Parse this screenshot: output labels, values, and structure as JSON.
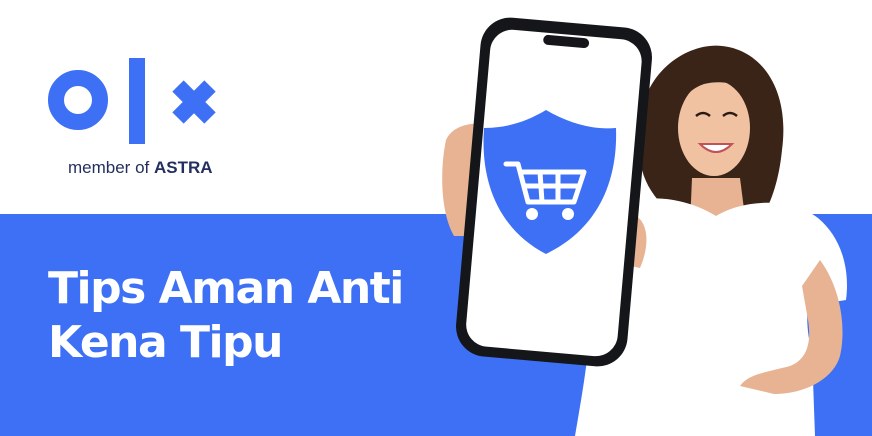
{
  "brand": {
    "tagline_prefix": "member of",
    "tagline_brand": "ASTRA",
    "logo_color": "#3d70f5",
    "text_color": "#23305f"
  },
  "headline": {
    "line1": "Tips Aman Anti",
    "line2": "Kena Tipu"
  },
  "colors": {
    "band": "#3d70f5",
    "shield": "#3d70f5",
    "phone_frame": "#15161a"
  },
  "icons": {
    "phone_screen": "shield-cart-icon"
  }
}
